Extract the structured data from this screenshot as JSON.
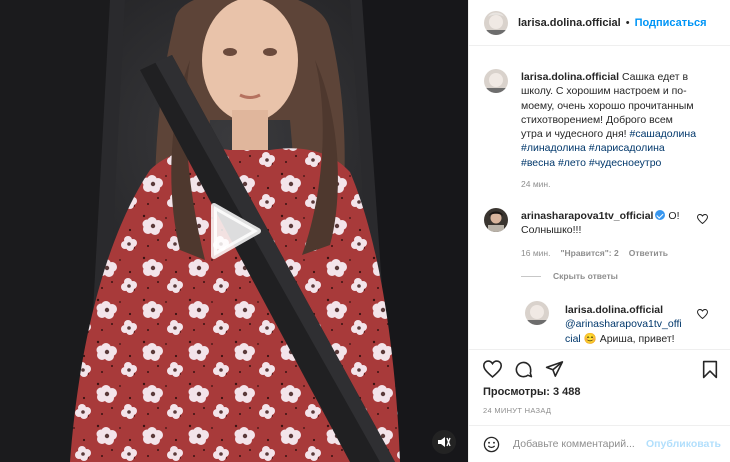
{
  "post": {
    "author": "larisa.dolina.official",
    "follow_label": "Подписаться",
    "separator": "•"
  },
  "caption": {
    "user": "larisa.dolina.official",
    "text_lines": [
      "Сашка едет в",
      "школу. С хорошим настроем и по-",
      "моему, очень хорошо прочитанным",
      "стихотворением! Доброго всем",
      "утра и чудесного дня!"
    ],
    "tags": [
      "#сашадолина",
      "#линадолина",
      "#ларисадолина",
      "#весна",
      "#лето",
      "#чудесноеутро"
    ],
    "time": "24 мин."
  },
  "comment": {
    "user": "arinasharapova1tv_official",
    "text_line1": "О!",
    "text_line2": "Солнышко!!!",
    "time": "16 мин.",
    "likes": "\"Нравится\": 2",
    "reply_label": "Ответить",
    "hide_replies": "Скрыть ответы"
  },
  "reply": {
    "user": "larisa.dolina.official",
    "mention_a": "@arinasharapova1tv_offi",
    "mention_b": "cial",
    "text": "Ариша, привет!"
  },
  "stats": {
    "views": "Просмотры: 3 488",
    "time_ago": "24 МИНУТ НАЗАД"
  },
  "composer": {
    "placeholder": "Добавьте комментарий...",
    "publish": "Опубликовать"
  },
  "colors": {
    "accent": "#0095f6",
    "hashtag": "#00376b",
    "muted": "#8e8e8e",
    "dress": "#a83a3a"
  },
  "icons": [
    "heart-icon",
    "comment-icon",
    "share-icon",
    "bookmark-icon",
    "emoji-icon",
    "play-icon",
    "sound-icon",
    "verified-icon"
  ]
}
